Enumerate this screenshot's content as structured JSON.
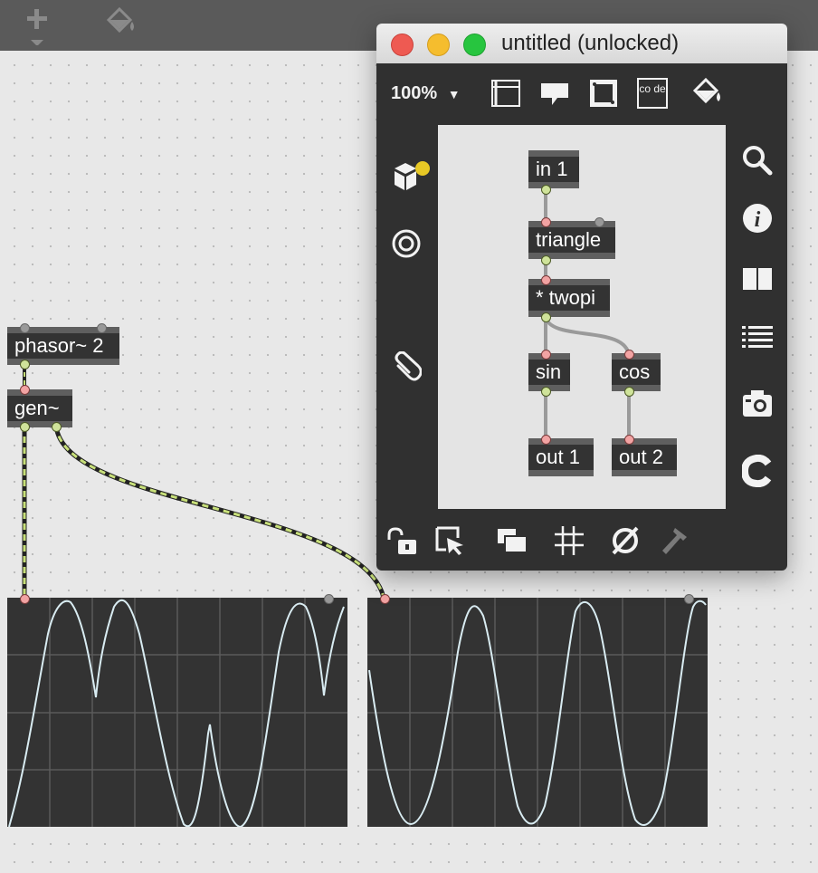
{
  "main_patcher": {
    "objects": {
      "phasor": "phasor~ 2",
      "gen": "gen~"
    }
  },
  "editor_window": {
    "title": "untitled (unlocked)",
    "zoom": "100%",
    "objects": {
      "in1": "in 1",
      "triangle": "triangle",
      "twopi": "* twopi",
      "sin": "sin",
      "cos": "cos",
      "out1": "out 1",
      "out2": "out 2"
    },
    "toolbar_icons": [
      "presentation-icon",
      "comment-icon",
      "fullscreen-icon",
      "code-icon",
      "paint-bucket-icon"
    ],
    "left_icons": [
      "object-browser-icon",
      "target-icon",
      "attach-icon"
    ],
    "right_icons": [
      "search-icon",
      "info-icon",
      "book-icon",
      "list-icon",
      "camera-icon",
      "c-icon"
    ],
    "bottom_icons": [
      "lock-icon",
      "select-icon",
      "layers-icon",
      "grid-icon",
      "null-icon",
      "hammer-icon"
    ],
    "traffic_colors": [
      "#ee5a52",
      "#f5bd2e",
      "#27c53f"
    ],
    "code_label": "co de"
  },
  "colors": {
    "object_bg": "#333333",
    "scope_line": "#d9ecf2",
    "patch_cord": "#c8e07a"
  }
}
